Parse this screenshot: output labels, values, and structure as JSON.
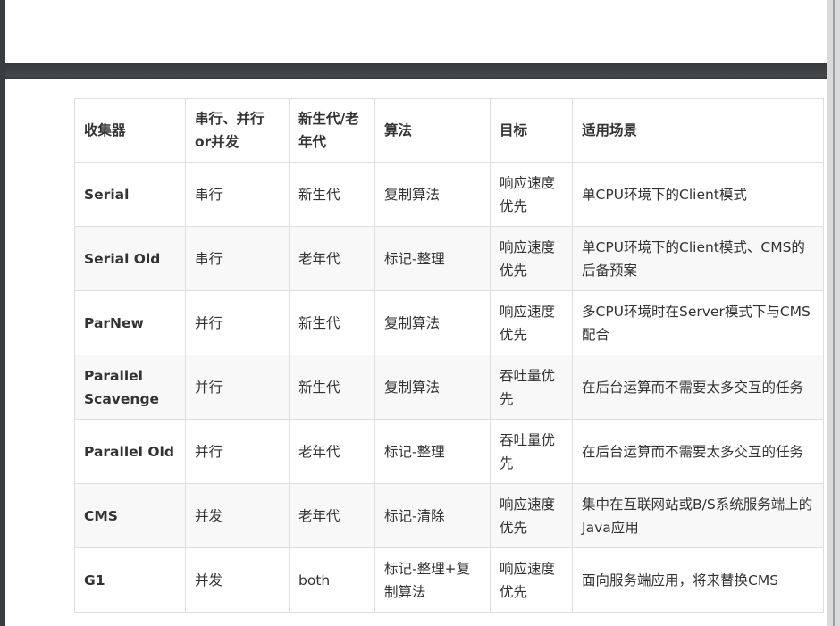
{
  "table": {
    "headers": [
      "收集器",
      "串行、并行or并发",
      "新生代/老年代",
      "算法",
      "目标",
      "适用场景"
    ],
    "rows": [
      [
        "Serial",
        "串行",
        "新生代",
        "复制算法",
        "响应速度优先",
        "单CPU环境下的Client模式"
      ],
      [
        "Serial Old",
        "串行",
        "老年代",
        "标记-整理",
        "响应速度优先",
        "单CPU环境下的Client模式、CMS的后备预案"
      ],
      [
        "ParNew",
        "并行",
        "新生代",
        "复制算法",
        "响应速度优先",
        "多CPU环境时在Server模式下与CMS配合"
      ],
      [
        "Parallel Scavenge",
        "并行",
        "新生代",
        "复制算法",
        "吞吐量优先",
        "在后台运算而不需要太多交互的任务"
      ],
      [
        "Parallel Old",
        "并行",
        "老年代",
        "标记-整理",
        "吞吐量优先",
        "在后台运算而不需要太多交互的任务"
      ],
      [
        "CMS",
        "并发",
        "老年代",
        "标记-清除",
        "响应速度优先",
        "集中在互联网站或B/S系统服务端上的Java应用"
      ],
      [
        "G1",
        "并发",
        "both",
        "标记-整理+复制算法",
        "响应速度优先",
        "面向服务端应用，将来替换CMS"
      ]
    ]
  }
}
